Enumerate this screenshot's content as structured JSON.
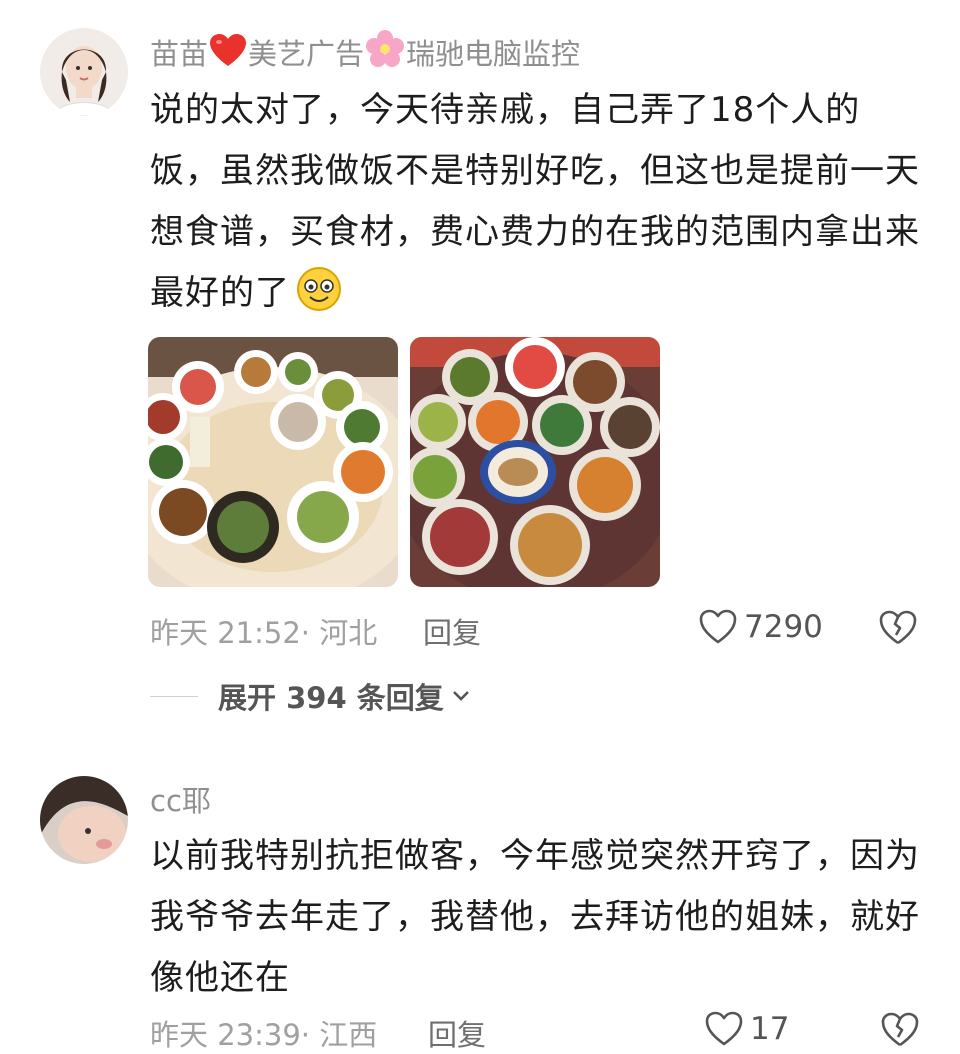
{
  "comments": [
    {
      "username": "苗苗",
      "badge_text_1": "美艺广告",
      "badge_text_2": "瑞驰电脑监控",
      "text": "说的太对了，今天待亲戚，自己弄了18个人的饭，虽然我做饭不是特别好吃，但这也是提前一天想食谱，买食材，费心费力的在我的范围内拿出来最好的了",
      "time_location": "昨天 21:52· 河北",
      "reply_label": "回复",
      "likes": "7290",
      "expand_label": "展开 394 条回复"
    },
    {
      "username": "cc耶",
      "text": "以前我特别抗拒做客，今年感觉突然开窍了，因为我爷爷去年走了，我替他，去拜访他的姐妹，就好像他还在",
      "time_location": "昨天 23:39· 江西",
      "reply_label": "回复",
      "likes": "17"
    }
  ],
  "colors": {
    "heart_red": "#e8322b",
    "meta_gray": "#a0a0a0"
  },
  "icons": [
    "heart-outline-icon",
    "broken-heart-icon",
    "chevron-down-icon",
    "red-heart-emoji",
    "flower-emoji",
    "smile-emoji"
  ]
}
